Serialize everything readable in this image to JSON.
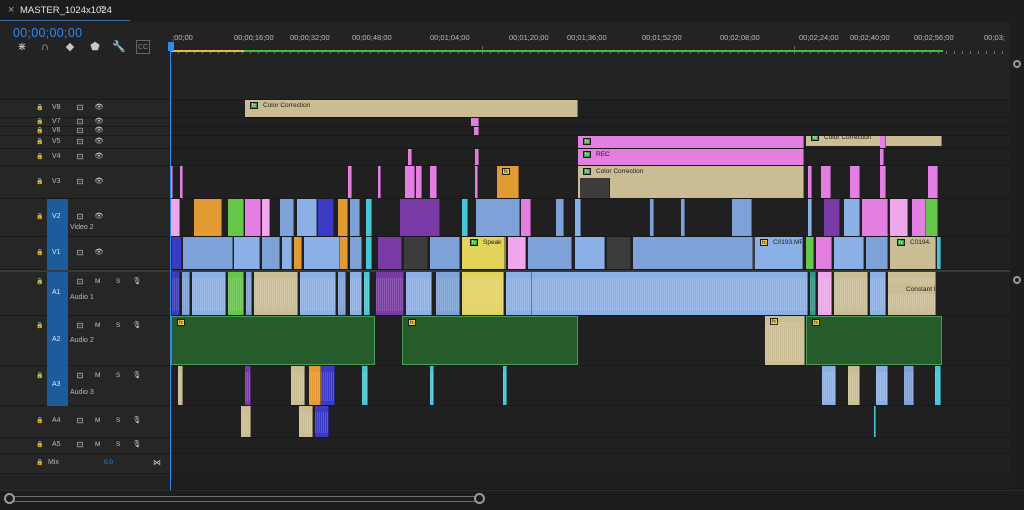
{
  "sequence": {
    "close_symbol": "×",
    "name": "MASTER_1024x1024",
    "menu_symbol": "≡"
  },
  "timecode": "00;00;00;00",
  "toolbar": [
    {
      "name": "snap-icon",
      "symbol": "⋇"
    },
    {
      "name": "linked-selection-icon",
      "symbol": "∩"
    },
    {
      "name": "add-marker-icon",
      "symbol": "◆"
    },
    {
      "name": "marker-icon",
      "symbol": "⬟"
    },
    {
      "name": "wrench-icon",
      "symbol": "🔧"
    },
    {
      "name": "captions-icon",
      "symbol": "CC"
    }
  ],
  "ruler": {
    "labels": [
      ";00;00",
      "00;00;16;00",
      "00;00;32;00",
      "00;00;48;00",
      "00;01;04;00",
      "00;01;20;00",
      "00;01;36;00",
      "00;01;52;00",
      "00;02;08;00",
      "00;02;24;00",
      "00;02;40;00",
      "00;02;56;00",
      "00;03;"
    ]
  },
  "video_tracks": [
    {
      "id": "V8",
      "label": ""
    },
    {
      "id": "V7",
      "label": ""
    },
    {
      "id": "V6",
      "label": ""
    },
    {
      "id": "V5",
      "label": ""
    },
    {
      "id": "V4",
      "label": ""
    },
    {
      "id": "V3",
      "label": ""
    },
    {
      "id": "V2",
      "label": "Video 2"
    },
    {
      "id": "V1",
      "label": ""
    }
  ],
  "audio_tracks": [
    {
      "id": "A1",
      "label": "Audio 1",
      "m": "M",
      "s": "S"
    },
    {
      "id": "A2",
      "label": "Audio 2",
      "m": "M",
      "s": "S"
    },
    {
      "id": "A3",
      "label": "Audio 3",
      "m": "M",
      "s": "S"
    },
    {
      "id": "A4",
      "label": "",
      "m": "M",
      "s": "S"
    },
    {
      "id": "A5",
      "label": "",
      "m": "M",
      "s": "S"
    }
  ],
  "mix": {
    "label": "Mix",
    "value": "0.0"
  },
  "clip_labels": {
    "color_correction": "Color Correction",
    "rec": "REC",
    "speak": "Speak",
    "c0193": "C0193.MP",
    "c0194": "C0194.",
    "constant_power": "Constant Pow",
    "fx": "fx"
  }
}
